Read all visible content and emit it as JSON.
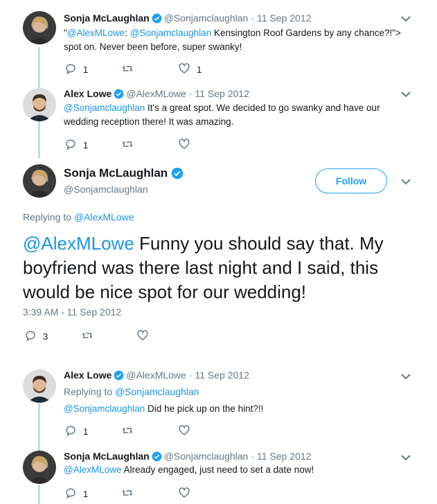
{
  "tweets": [
    {
      "name": "Sonja McLaughlan",
      "handle": "@Sonjamclaughlan",
      "date": "11 Sep 2012",
      "text_parts": [
        {
          "t": "\"",
          "m": false
        },
        {
          "t": "@AlexMLowe",
          "m": true
        },
        {
          "t": ": ",
          "m": false
        },
        {
          "t": "@Sonjamclaughlan",
          "m": true
        },
        {
          "t": " Kensington Roof Gardens by any chance?!\"> spot on. Never been before, super swanky!",
          "m": false
        }
      ],
      "reply_count": "1",
      "retweet_count": "",
      "like_count": "1"
    },
    {
      "name": "Alex Lowe",
      "handle": "@AlexMLowe",
      "date": "11 Sep 2012",
      "text_parts": [
        {
          "t": "@Sonjamclaughlan",
          "m": true
        },
        {
          "t": " It's a great spot. We decided to go swanky and have our wedding reception there! It was amazing.",
          "m": false
        }
      ],
      "reply_count": "1",
      "retweet_count": "",
      "like_count": ""
    }
  ],
  "main_tweet": {
    "name": "Sonja McLaughlan",
    "handle": "@Sonjamclaughlan",
    "follow_label": "Follow",
    "replying_prefix": "Replying to",
    "replying_handle": "@AlexMLowe",
    "mention": "@AlexMLowe",
    "text": " Funny you should say that. My boyfriend was there last night and I said, this would be nice spot for our wedding!",
    "timestamp": "3:39 AM - 11 Sep 2012",
    "reply_count": "3"
  },
  "replies": [
    {
      "name": "Alex Lowe",
      "handle": "@AlexMLowe",
      "date": "11 Sep 2012",
      "replying_prefix": "Replying to",
      "replying_handle": "@Sonjamclaughlan",
      "mention": "@Sonjamclaughlan",
      "text": " Did he pick up on the hint?!!",
      "reply_count": "1"
    },
    {
      "name": "Sonja McLaughlan",
      "handle": "@Sonjamclaughlan",
      "date": "11 Sep 2012",
      "mention": "@AlexMLowe",
      "text": " Already engaged, just need to set a date now!",
      "reply_count": "1"
    }
  ],
  "dot": "·",
  "colors": {
    "accent": "#1da1f2",
    "mention": "#1b95e0",
    "muted": "#657786",
    "thread_line": "#b6dcef"
  }
}
